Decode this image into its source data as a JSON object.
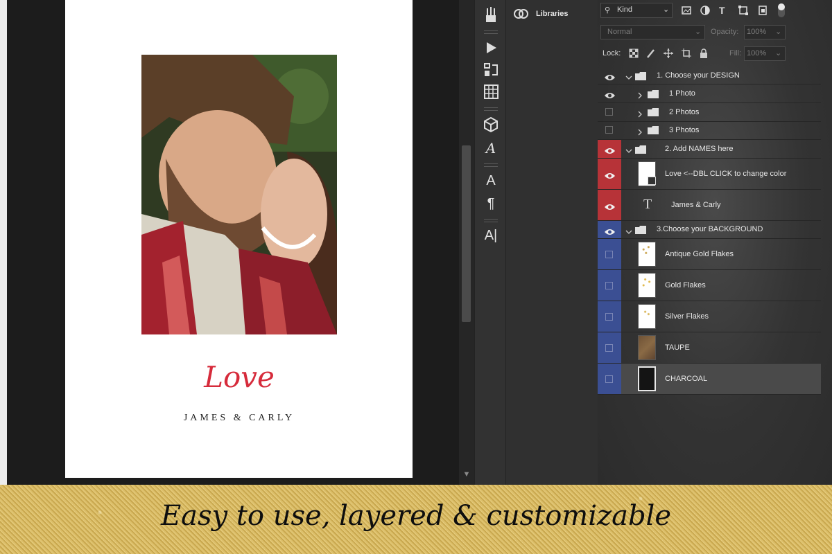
{
  "document": {
    "love_text": "Love",
    "names_text": "JAMES & CARLY"
  },
  "libraries": {
    "label": "Libraries"
  },
  "layers_panel": {
    "filter_kind": "Kind",
    "blend_mode": "Normal",
    "opacity_label": "Opacity:",
    "opacity_value": "100%",
    "lock_label": "Lock:",
    "fill_label": "Fill:",
    "fill_value": "100%"
  },
  "layers": [
    {
      "label": "1. Choose your DESIGN",
      "visible": true,
      "type": "group",
      "expanded": true,
      "color": "none"
    },
    {
      "label": "1 Photo",
      "visible": true,
      "type": "group",
      "expanded": false,
      "color": "none"
    },
    {
      "label": "2 Photos",
      "visible": false,
      "type": "group",
      "expanded": false,
      "color": "none"
    },
    {
      "label": "3 Photos",
      "visible": false,
      "type": "group",
      "expanded": false,
      "color": "none"
    },
    {
      "label": "2. Add NAMES here",
      "visible": true,
      "type": "group",
      "expanded": true,
      "color": "red"
    },
    {
      "label": "Love <--DBL CLICK to change color",
      "visible": true,
      "type": "shape",
      "color": "red"
    },
    {
      "label": "James & Carly",
      "visible": true,
      "type": "text",
      "color": "red"
    },
    {
      "label": "3.Choose your BACKGROUND",
      "visible": true,
      "type": "group",
      "expanded": true,
      "color": "blue"
    },
    {
      "label": "Antique Gold Flakes",
      "visible": false,
      "type": "image",
      "color": "blue"
    },
    {
      "label": "Gold Flakes",
      "visible": false,
      "type": "image",
      "color": "blue"
    },
    {
      "label": "Silver Flakes",
      "visible": false,
      "type": "image",
      "color": "blue"
    },
    {
      "label": "TAUPE",
      "visible": false,
      "type": "image",
      "color": "blue"
    },
    {
      "label": "CHARCOAL",
      "visible": false,
      "type": "image",
      "color": "blue",
      "selected": true
    }
  ],
  "banner": {
    "text": "Easy to use, layered & customizable"
  },
  "colors": {
    "red_tag": "#b73338",
    "blue_tag": "#3b4f93",
    "love": "#d62b3b",
    "gold": "#d4b560"
  },
  "icons": [
    "eye-icon",
    "folder-icon",
    "text-layer-icon",
    "play-icon",
    "grid-icon",
    "paragraph-icon",
    "libraries-icon"
  ]
}
